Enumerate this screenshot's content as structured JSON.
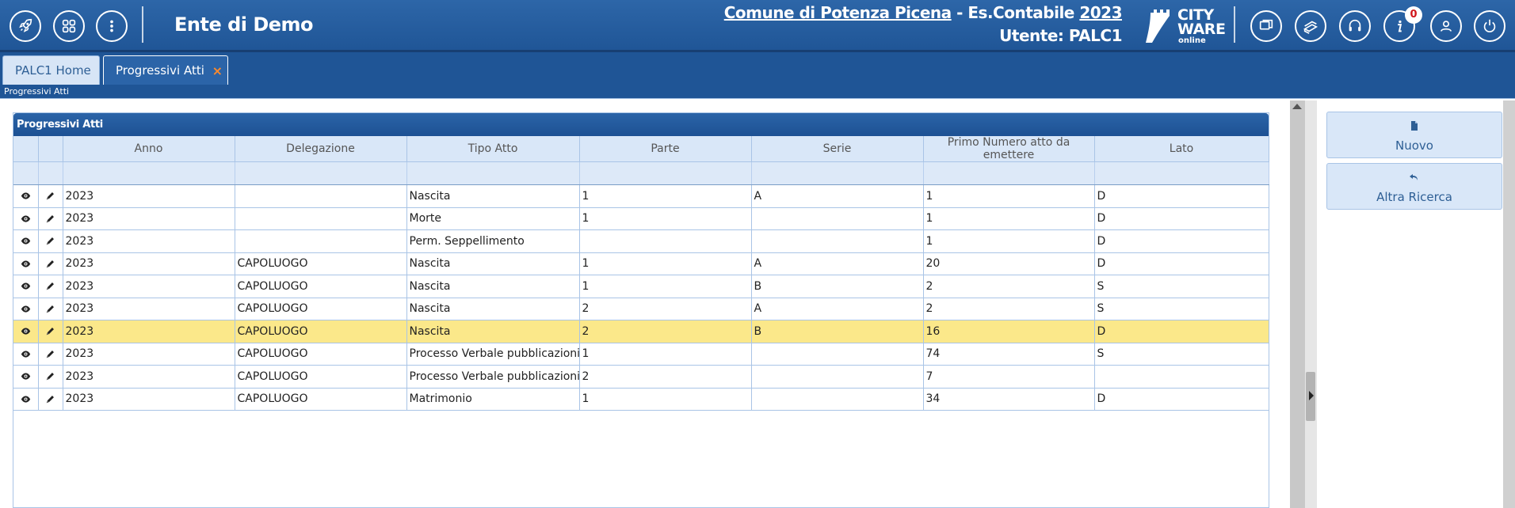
{
  "header": {
    "app_title": "Ente di Demo",
    "ente_name": "Comune di Potenza Picena",
    "ente_sep": " - ",
    "es_label": "Es.Contabile ",
    "es_year": "2023",
    "user_line": "Utente: PALC1",
    "logo_line1": "CITY",
    "logo_line2": "WARE",
    "logo_sub": "online",
    "notification_count": "0",
    "left_icons": [
      "rocket-icon",
      "apps-grid-icon",
      "more-vertical-icon"
    ],
    "right_icons": [
      "windows-icon",
      "books-icon",
      "headset-icon",
      "info-icon",
      "user-icon",
      "power-icon"
    ]
  },
  "tabs": [
    {
      "label": "PALC1 Home",
      "active": false
    },
    {
      "label": "Progressivi Atti",
      "active": true,
      "close": "×"
    }
  ],
  "breadcrumb": "Progressivi Atti",
  "grid": {
    "caption": "Progressivi Atti",
    "columns": [
      "",
      "",
      "Anno",
      "Delegazione",
      "Tipo Atto",
      "Parte",
      "Serie",
      "Primo Numero atto da emettere",
      "Lato"
    ],
    "rows": [
      {
        "anno": "2023",
        "delegazione": "",
        "tipo": "Nascita",
        "parte": "1",
        "serie": "A",
        "primo": "1",
        "lato": "D"
      },
      {
        "anno": "2023",
        "delegazione": "",
        "tipo": "Morte",
        "parte": "1",
        "serie": "",
        "primo": "1",
        "lato": "D"
      },
      {
        "anno": "2023",
        "delegazione": "",
        "tipo": "Perm. Seppellimento",
        "parte": "",
        "serie": "",
        "primo": "1",
        "lato": "D"
      },
      {
        "anno": "2023",
        "delegazione": "CAPOLUOGO",
        "tipo": "Nascita",
        "parte": "1",
        "serie": "A",
        "primo": "20",
        "lato": "D"
      },
      {
        "anno": "2023",
        "delegazione": "CAPOLUOGO",
        "tipo": "Nascita",
        "parte": "1",
        "serie": "B",
        "primo": "2",
        "lato": "S"
      },
      {
        "anno": "2023",
        "delegazione": "CAPOLUOGO",
        "tipo": "Nascita",
        "parte": "2",
        "serie": "A",
        "primo": "2",
        "lato": "S"
      },
      {
        "anno": "2023",
        "delegazione": "CAPOLUOGO",
        "tipo": "Nascita",
        "parte": "2",
        "serie": "B",
        "primo": "16",
        "lato": "D"
      },
      {
        "anno": "2023",
        "delegazione": "CAPOLUOGO",
        "tipo": "Processo Verbale pubblicazioni M",
        "parte": "1",
        "serie": "",
        "primo": "74",
        "lato": "S"
      },
      {
        "anno": "2023",
        "delegazione": "CAPOLUOGO",
        "tipo": "Processo Verbale pubblicazioni M",
        "parte": "2",
        "serie": "",
        "primo": "7",
        "lato": ""
      },
      {
        "anno": "2023",
        "delegazione": "CAPOLUOGO",
        "tipo": "Matrimonio",
        "parte": "1",
        "serie": "",
        "primo": "34",
        "lato": "D"
      }
    ],
    "selected_row": 6
  },
  "actions": {
    "nuovo": "Nuovo",
    "altra_ricerca": "Altra Ricerca"
  },
  "colors": {
    "header_bg": "#1f5596",
    "selected_row": "#fbe88a",
    "grid_header": "#d9e7f8"
  }
}
